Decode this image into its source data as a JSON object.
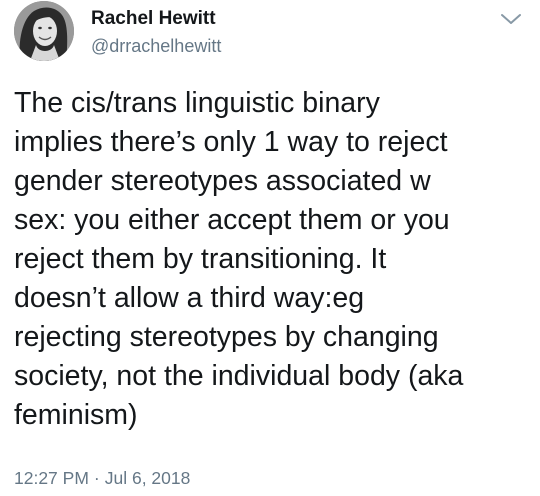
{
  "author": {
    "display_name": "Rachel Hewitt",
    "handle": "@drrachelhewitt",
    "avatar_icon": "profile-photo"
  },
  "menu": {
    "icon": "chevron-down-icon",
    "color": "#657786"
  },
  "tweet": {
    "lines": [
      "The cis/trans linguistic binary",
      "implies there’s only 1 way to reject",
      "gender stereotypes associated w",
      "sex: you either accept them or you",
      "reject them by transitioning. It",
      "doesn’t allow a third way:eg",
      "rejecting stereotypes by changing",
      "society, not the individual body (aka",
      "feminism)"
    ]
  },
  "meta": {
    "time": "12:27 PM",
    "separator": "·",
    "date": "Jul 6, 2018"
  },
  "colors": {
    "text": "#14171a",
    "secondary": "#657786",
    "background": "#ffffff"
  }
}
